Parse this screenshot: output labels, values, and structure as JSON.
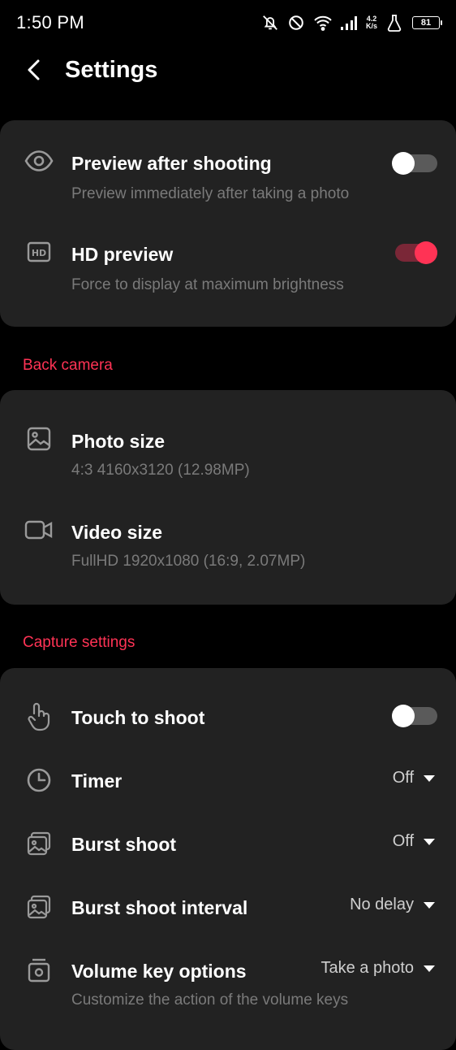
{
  "status_bar": {
    "time": "1:50 PM",
    "net_speed_value": "4.2",
    "net_speed_unit": "K/s",
    "battery": "81",
    "icons": [
      "bell-off-icon",
      "do-not-disturb-icon",
      "wifi-icon",
      "signal-icon",
      "flask-icon",
      "battery-icon"
    ]
  },
  "header": {
    "title": "Settings",
    "back_icon": "chevron-left-icon"
  },
  "colors": {
    "background": "#000000",
    "card": "#222222",
    "accent": "#ff3355",
    "subtitle": "#7a7a7a"
  },
  "preview_card": {
    "items": [
      {
        "title": "Preview after shooting",
        "subtitle": "Preview immediately after taking a photo",
        "icon": "eye-icon",
        "toggle": "off"
      },
      {
        "title": "HD preview",
        "subtitle": "Force to display at maximum brightness",
        "icon": "hd-icon",
        "toggle": "on"
      }
    ]
  },
  "back_camera": {
    "label": "Back camera",
    "items": [
      {
        "title": "Photo size",
        "subtitle": "4:3 4160x3120 (12.98MP)",
        "icon": "image-icon"
      },
      {
        "title": "Video size",
        "subtitle": "FullHD 1920x1080 (16:9, 2.07MP)",
        "icon": "video-camera-icon"
      }
    ]
  },
  "capture_settings": {
    "label": "Capture settings",
    "items": [
      {
        "title": "Touch to shoot",
        "icon": "touch-icon",
        "toggle": "off"
      },
      {
        "title": "Timer",
        "icon": "clock-icon",
        "value": "Off"
      },
      {
        "title": "Burst shoot",
        "icon": "burst-icon",
        "value": "Off"
      },
      {
        "title": "Burst shoot interval",
        "icon": "burst-interval-icon",
        "value": "No delay"
      },
      {
        "title": "Volume key options",
        "subtitle": "Customize the action of the volume keys",
        "icon": "volume-key-icon",
        "value": "Take a photo"
      }
    ]
  }
}
